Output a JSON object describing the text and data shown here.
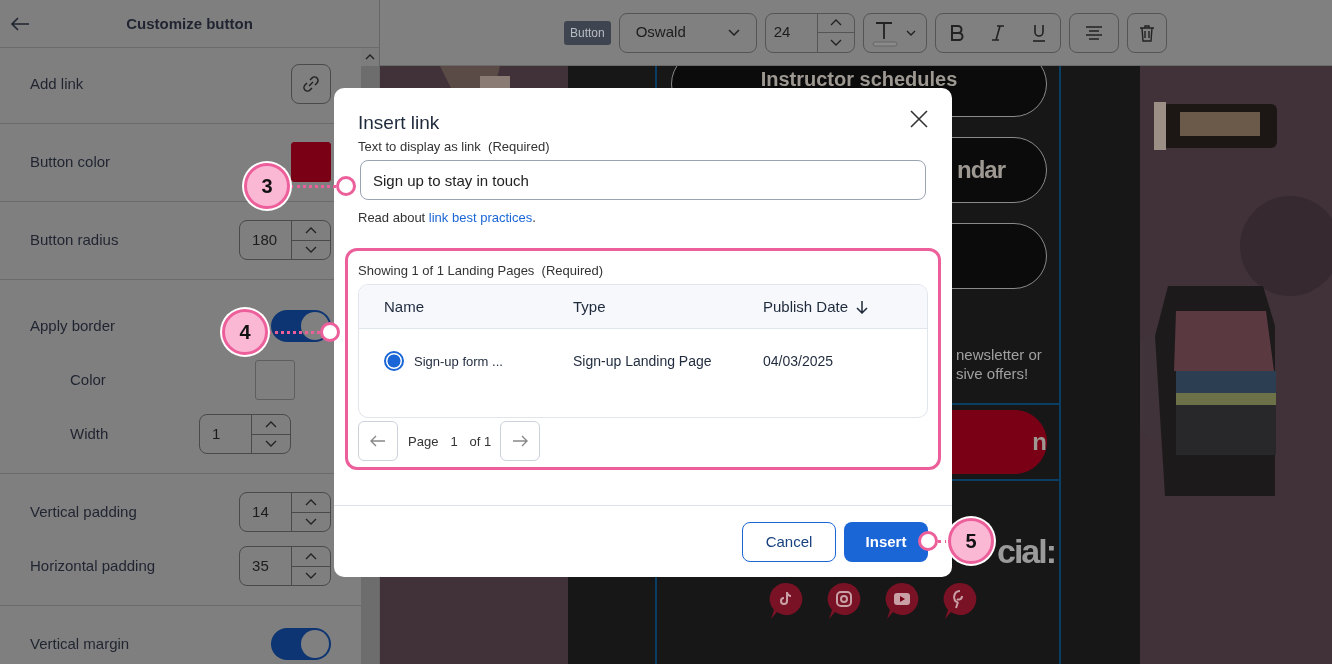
{
  "panel": {
    "title": "Customize button",
    "sections": [
      {
        "rows": [
          {
            "kind": "link",
            "label": "Add link"
          }
        ]
      },
      {
        "rows": [
          {
            "kind": "color",
            "label": "Button color",
            "color": "#7a0016"
          }
        ]
      },
      {
        "rows": [
          {
            "kind": "number",
            "label": "Button radius",
            "value": "180"
          }
        ]
      },
      {
        "rows": [
          {
            "kind": "toggle",
            "label": "Apply border",
            "on": true,
            "children": [
              {
                "kind": "color",
                "label": "Color"
              },
              {
                "kind": "number",
                "label": "Width",
                "value": "1"
              }
            ]
          }
        ]
      },
      {
        "rows": [
          {
            "kind": "number",
            "label": "Vertical padding",
            "value": "14"
          },
          {
            "kind": "number",
            "label": "Horizontal padding",
            "value": "35"
          }
        ]
      },
      {
        "rows": [
          {
            "kind": "toggle",
            "label": "Vertical margin",
            "on": true
          }
        ]
      }
    ]
  },
  "toolbar": {
    "tag": "Button",
    "font": "Oswald",
    "size": "24"
  },
  "canvas": {
    "items": [
      {
        "kind": "outline_button",
        "text": "Instructor schedules"
      },
      {
        "kind": "outline_button",
        "text": "ndar"
      },
      {
        "kind": "outline_button"
      },
      {
        "kind": "text",
        "lines": [
          "newsletter or",
          "sive offers!"
        ]
      },
      {
        "kind": "filled_button",
        "text": "n"
      },
      {
        "kind": "heading",
        "text": "cial:"
      },
      {
        "kind": "social"
      }
    ]
  },
  "dialog": {
    "title": "Insert link",
    "field_label": "Text to display as link  (Required)",
    "field_value": "Sign up to stay in touch",
    "help_text": "Read about ",
    "help_link": "link best practices",
    "help_end": ".",
    "caption": "Showing 1 of 1 Landing Pages  (Required)",
    "columns": [
      {
        "label": "Name"
      },
      {
        "label": "Type"
      },
      {
        "label": "Publish Date",
        "sorted": true
      }
    ],
    "rows": [
      {
        "name": "Sign-up form ...",
        "type": "Sign-up Landing Page",
        "date": "04/03/2025",
        "selected": true
      }
    ],
    "pager": {
      "label": "Page",
      "page": "1",
      "of": "of 1"
    },
    "buttons": [
      {
        "label": "Cancel",
        "kind": "secondary"
      },
      {
        "label": "Insert",
        "kind": "primary"
      }
    ]
  },
  "callouts": [
    {
      "label": "3"
    },
    {
      "label": "4"
    },
    {
      "label": "5"
    }
  ]
}
